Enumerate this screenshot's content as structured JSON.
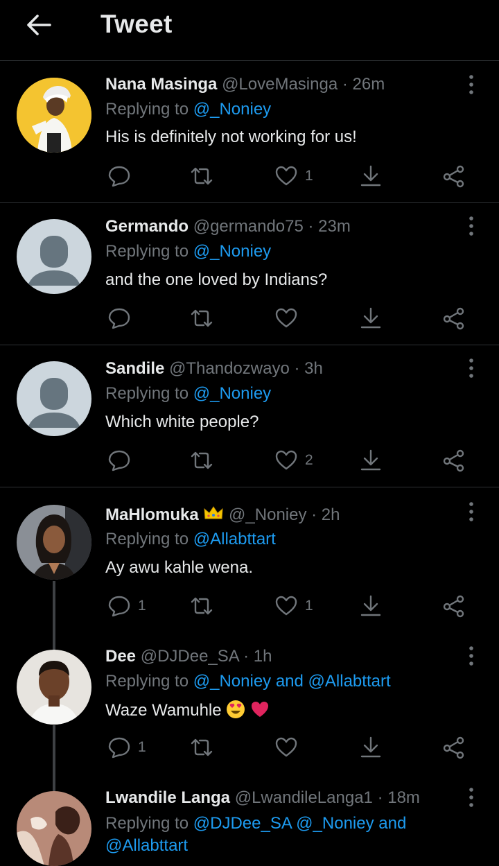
{
  "header": {
    "title": "Tweet",
    "back_icon": "arrow-left-icon"
  },
  "colors": {
    "link": "#1d9bf0",
    "muted": "#71767b",
    "text": "#e7e9ea",
    "background": "#000000"
  },
  "tweets": [
    {
      "name": "Nana Masinga",
      "handle": "@LoveMasinga",
      "time": "· 26m",
      "replying_prefix": "Replying to",
      "replying_links": "@_Noniey",
      "text": "His is definitely not working for us!",
      "reply_count": "",
      "like_count": "1"
    },
    {
      "name": "Germando",
      "handle": "@germando75",
      "time": "· 23m",
      "replying_prefix": "Replying to",
      "replying_links": "@_Noniey",
      "text": "and the one loved by Indians?",
      "reply_count": "",
      "like_count": ""
    },
    {
      "name": "Sandile",
      "handle": "@Thandozwayo",
      "time": "· 3h",
      "replying_prefix": "Replying to",
      "replying_links": "@_Noniey",
      "text": "Which white people?",
      "reply_count": "",
      "like_count": "2"
    },
    {
      "name": "MaHlomuka",
      "handle": "@_Noniey",
      "time": "· 2h",
      "replying_prefix": "Replying to",
      "replying_links": "@Allabttart",
      "text": "Ay awu kahle wena.",
      "reply_count": "1",
      "like_count": "1"
    },
    {
      "name": "Dee",
      "handle": "@DJDee_SA",
      "time": "· 1h",
      "replying_prefix": "Replying to",
      "replying_links": "@_Noniey and @Allabttart",
      "text": "Waze Wamuhle",
      "reply_count": "1",
      "like_count": ""
    },
    {
      "name": "Lwandile Langa",
      "handle": "@LwandileLanga1",
      "time": "· 18m",
      "replying_prefix": "Replying to",
      "replying_links": "@DJDee_SA @_Noniey and",
      "replying_links_2": "@Allabttart",
      "text": "",
      "reply_count": "",
      "like_count": ""
    }
  ]
}
